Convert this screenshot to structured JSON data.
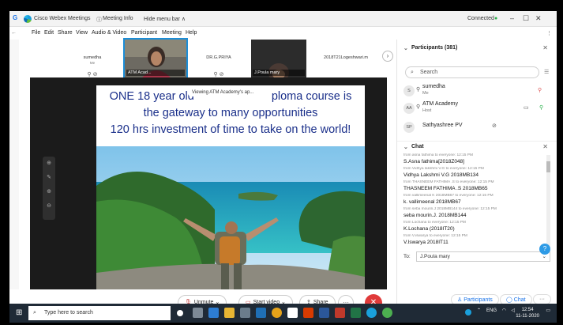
{
  "window": {
    "tab_glyph": "G",
    "app_title": "Cisco Webex Meetings",
    "meeting_info": "Meeting Info",
    "hide_menu": "Hide menu bar ∧",
    "status": "Connected",
    "status_color": "#2bb24c"
  },
  "menu": {
    "items": [
      "File",
      "Edit",
      "Share",
      "View",
      "Audio & Video",
      "Participant",
      "Meeting",
      "Help"
    ]
  },
  "thumbnails": [
    {
      "name": "sumedha",
      "sub": "Me",
      "video": false
    },
    {
      "name": "ATM Acad...",
      "sub": "",
      "video": true,
      "active": true
    },
    {
      "name": "DR.G.PRIYA",
      "sub": "",
      "video": false
    },
    {
      "name": "J.Poula mary",
      "sub": "",
      "video": true
    },
    {
      "name": "2018T21Logeshwari.m",
      "sub": "",
      "video": false
    }
  ],
  "slide": {
    "line1": "ONE 18 year old",
    "line1_rest": "ploma course is",
    "line2": "the gateway to many opportunities",
    "line3": "120 hrs investment of time to take on the world!",
    "viewing": "Viewing ATM Academy's ap..."
  },
  "controls": {
    "unmute": "Unmute",
    "start_video": "Start video",
    "share": "Share",
    "more": "···",
    "end_color": "#e03a3a"
  },
  "participants": {
    "title": "Participants (381)",
    "search_placeholder": "Search",
    "list": [
      {
        "initials": "S",
        "name": "sumedha",
        "role": "Me"
      },
      {
        "initials": "AA",
        "name": "ATM Academy",
        "role": "Host"
      },
      {
        "initials": "SP",
        "name": "Sathyashree PV",
        "role": ""
      }
    ]
  },
  "chat": {
    "title": "Chat",
    "messages": [
      {
        "meta": "from asna fathima to everyone:   12:15 PM",
        "text": "S.Asna fathima[2018Z048]"
      },
      {
        "meta": "from Vidhya lakshmi V.G to everyone:   12:15 PM",
        "text": "Vidhya Lakshmi V.G 2018MB134"
      },
      {
        "meta": "from THASNEEM FATHIMA .S to everyone:   12:15 PM",
        "text": "THASNEEM FATHIMA .S  2018MB65"
      },
      {
        "meta": "from vallimeenal K 2018MB67 to everyone:   12:15 PM",
        "text": "k. vallimeenal 2018MB67"
      },
      {
        "meta": "from seba mourin.J 2018MB144 to everyone:   12:15 PM",
        "text": "seba mourin.J. 2018MB144"
      },
      {
        "meta": "from Lochana to everyone:   12:15 PM",
        "text": "K.Lochana (2018IT20)"
      },
      {
        "meta": "from V.iswarya to everyone:   12:15 PM",
        "text": "V.Iswarya 2018IT11"
      }
    ],
    "to_label": "To:",
    "to_value": "J.Poula mary"
  },
  "panel_buttons": {
    "participants": "Participants",
    "chat": "Chat"
  },
  "taskbar": {
    "search_placeholder": "Type here to search",
    "time": "12:54",
    "date": "11-11-2020",
    "lang": "ENG"
  }
}
